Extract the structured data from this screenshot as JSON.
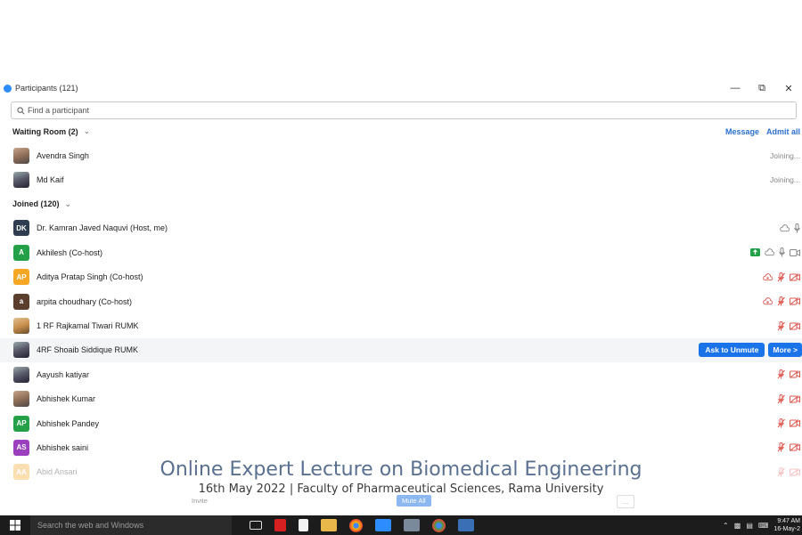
{
  "window": {
    "title": "Participants (121)",
    "search_placeholder": "Find a participant"
  },
  "waiting_room": {
    "label": "Waiting Room (2)",
    "message_label": "Message",
    "admit_all_label": "Admit all",
    "people": [
      {
        "name": "Avendra Singh",
        "status": "Joining..."
      },
      {
        "name": "Md Kaif",
        "status": "Joining..."
      }
    ]
  },
  "joined": {
    "label": "Joined (120)",
    "people": [
      {
        "initials": "DK",
        "name": "Dr. Kamran Javed Naquvi (Host, me)",
        "color": "#2f3d52"
      },
      {
        "initials": "A",
        "name": "Akhilesh (Co-host)",
        "color": "#24a148"
      },
      {
        "initials": "AP",
        "name": "Aditya Pratap Singh (Co-host)",
        "color": "#f5a623"
      },
      {
        "initials": "a",
        "name": "arpita choudhary (Co-host)",
        "color": "#5a3e2e"
      },
      {
        "initials": "",
        "name": "1 RF Rajkamal Tiwari RUMK",
        "color": ""
      },
      {
        "initials": "",
        "name": "4RF Shoaib Siddique RUMK",
        "color": ""
      },
      {
        "initials": "",
        "name": "Aayush katiyar",
        "color": ""
      },
      {
        "initials": "",
        "name": "Abhishek Kumar",
        "color": ""
      },
      {
        "initials": "AP",
        "name": "Abhishek Pandey",
        "color": "#24a148"
      },
      {
        "initials": "AS",
        "name": "Abhishek saini",
        "color": "#9b3fbf"
      },
      {
        "initials": "AA",
        "name": "Abid Ansari",
        "color": "#f5a623"
      }
    ],
    "ask_to_unmute_label": "Ask to Unmute",
    "more_label": "More >"
  },
  "overlay": {
    "title": "Online Expert Lecture on Biomedical Engineering",
    "subtitle": "16th May 2022  | Faculty of Pharmaceutical Sciences, Rama University"
  },
  "bottom": {
    "invite_label": "Invite",
    "mute_all_label": "Mute All",
    "dots_label": "..."
  },
  "taskbar": {
    "search_text": "Search the web and Windows",
    "time": "9:47 AM",
    "date": "16-May-2"
  },
  "colors": {
    "accent": "#1a73e8",
    "muted_red": "#e0574f",
    "taskbar": "#1c1c1c"
  }
}
